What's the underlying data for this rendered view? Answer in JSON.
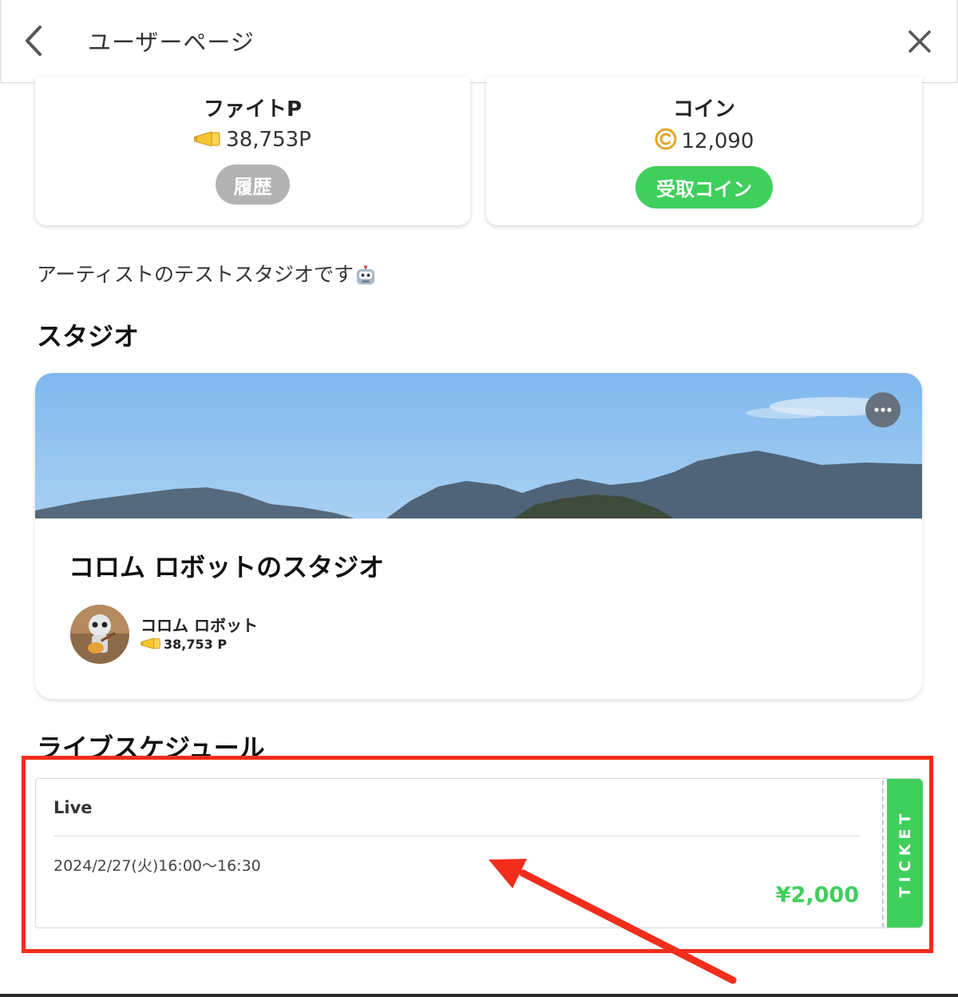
{
  "header": {
    "title": "ユーザーページ",
    "back_icon": "chevron-left-icon",
    "close_icon": "close-icon"
  },
  "stats": {
    "fight": {
      "title": "ファイトP",
      "value": "38,753P",
      "icon": "megaphone-icon",
      "button_label": "履歴"
    },
    "coin": {
      "title": "コイン",
      "value": "12,090",
      "icon": "coin-icon",
      "button_label": "受取コイン"
    }
  },
  "bio": {
    "text": "アーティストのテストスタジオです",
    "emoji": "robot-face-icon"
  },
  "studio_section": {
    "title": "スタジオ",
    "card": {
      "name": "コロム ロボットのスタジオ",
      "owner_name": "コロム ロボット",
      "owner_points": "38,753 P",
      "menu_icon": "more-horizontal-icon"
    }
  },
  "schedule_section": {
    "title": "ライブスケジュール",
    "items": [
      {
        "name": "Live",
        "datetime": "2024/2/27(火)16:00〜16:30",
        "price": "¥2,000",
        "ticket_label": "TICKET"
      }
    ]
  },
  "colors": {
    "accent_green": "#3fcf5c",
    "history_gray": "#b3b3b3",
    "annotation_red": "#f22d1b"
  }
}
